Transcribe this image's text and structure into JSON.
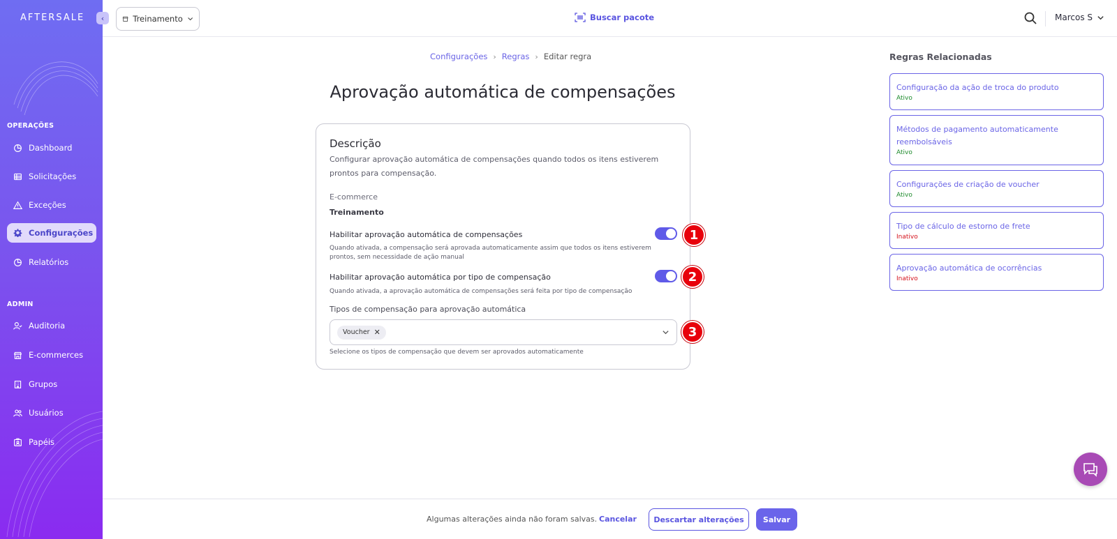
{
  "app": {
    "logo": "AFTERSALE"
  },
  "sidebar": {
    "sections": [
      {
        "label": "OPERAÇÕES"
      },
      {
        "label": "ADMIN"
      }
    ],
    "items": [
      {
        "label": "Dashboard",
        "icon": "dashboard-icon"
      },
      {
        "label": "Solicitações",
        "icon": "table-icon"
      },
      {
        "label": "Exceções",
        "icon": "warning-icon"
      },
      {
        "label": "Configurações",
        "icon": "gear-icon",
        "active": true
      },
      {
        "label": "Relatórios",
        "icon": "chart-pie-icon"
      },
      {
        "label": "Auditoria",
        "icon": "user-check-icon"
      },
      {
        "label": "E-commerces",
        "icon": "store-icon"
      },
      {
        "label": "Grupos",
        "icon": "building-icon"
      },
      {
        "label": "Usuários",
        "icon": "users-icon"
      },
      {
        "label": "Papéis",
        "icon": "id-badge-icon"
      }
    ]
  },
  "topbar": {
    "store_select": "Treinamento",
    "search_package": "Buscar pacote",
    "user": "Marcos S"
  },
  "breadcrumb": [
    "Configurações",
    "Regras",
    "Editar regra"
  ],
  "page": {
    "title": "Aprovação automática de compensações",
    "card": {
      "title": "Descrição",
      "description": "Configurar aprovação automática de compensações quando todos os itens estiverem prontos para compensação.",
      "ecommerce_label": "E-commerce",
      "ecommerce_value": "Treinamento",
      "toggle1": {
        "label": "Habilitar aprovação automática de compensações",
        "help": "Quando ativada, a compensação será aprovada automaticamente assim que todos os itens estiverem prontos, sem necessidade de ação manual",
        "enabled": true
      },
      "toggle2": {
        "label": "Habilitar aprovação automática por tipo de compensação",
        "help": "Quando ativada, a aprovação automática de compensações será feita por tipo de compensação",
        "enabled": true
      },
      "types_label": "Tipos de compensação para aprovação automática",
      "types_selected": [
        "Voucher"
      ],
      "types_help": "Selecione os tipos de compensação que devem ser aprovados automaticamente"
    },
    "markers": [
      "1",
      "2",
      "3"
    ]
  },
  "related": {
    "title": "Regras Relacionadas",
    "rules": [
      {
        "name": "Configuração da ação de troca do produto",
        "status": "Ativo"
      },
      {
        "name": "Métodos de pagamento automaticamente reembolsáveis",
        "status": "Ativo"
      },
      {
        "name": "Configurações de criação de voucher",
        "status": "Ativo"
      },
      {
        "name": "Tipo de cálculo de estorno de frete",
        "status": "Inativo"
      },
      {
        "name": "Aprovação automática de ocorrências",
        "status": "Inativo"
      }
    ]
  },
  "bottombar": {
    "message": "Algumas alterações ainda não foram salvas.",
    "cancel": "Cancelar",
    "discard": "Descartar alterações",
    "save": "Salvar"
  },
  "colors": {
    "accent": "#5f5ae8",
    "sidebar_top": "#6f6df2",
    "sidebar_bottom": "#8a2bf0",
    "marker": "#e8000b",
    "active_status": "#1d8a2c",
    "inactive_status": "#d4101a",
    "chat": "#a84ab5"
  }
}
